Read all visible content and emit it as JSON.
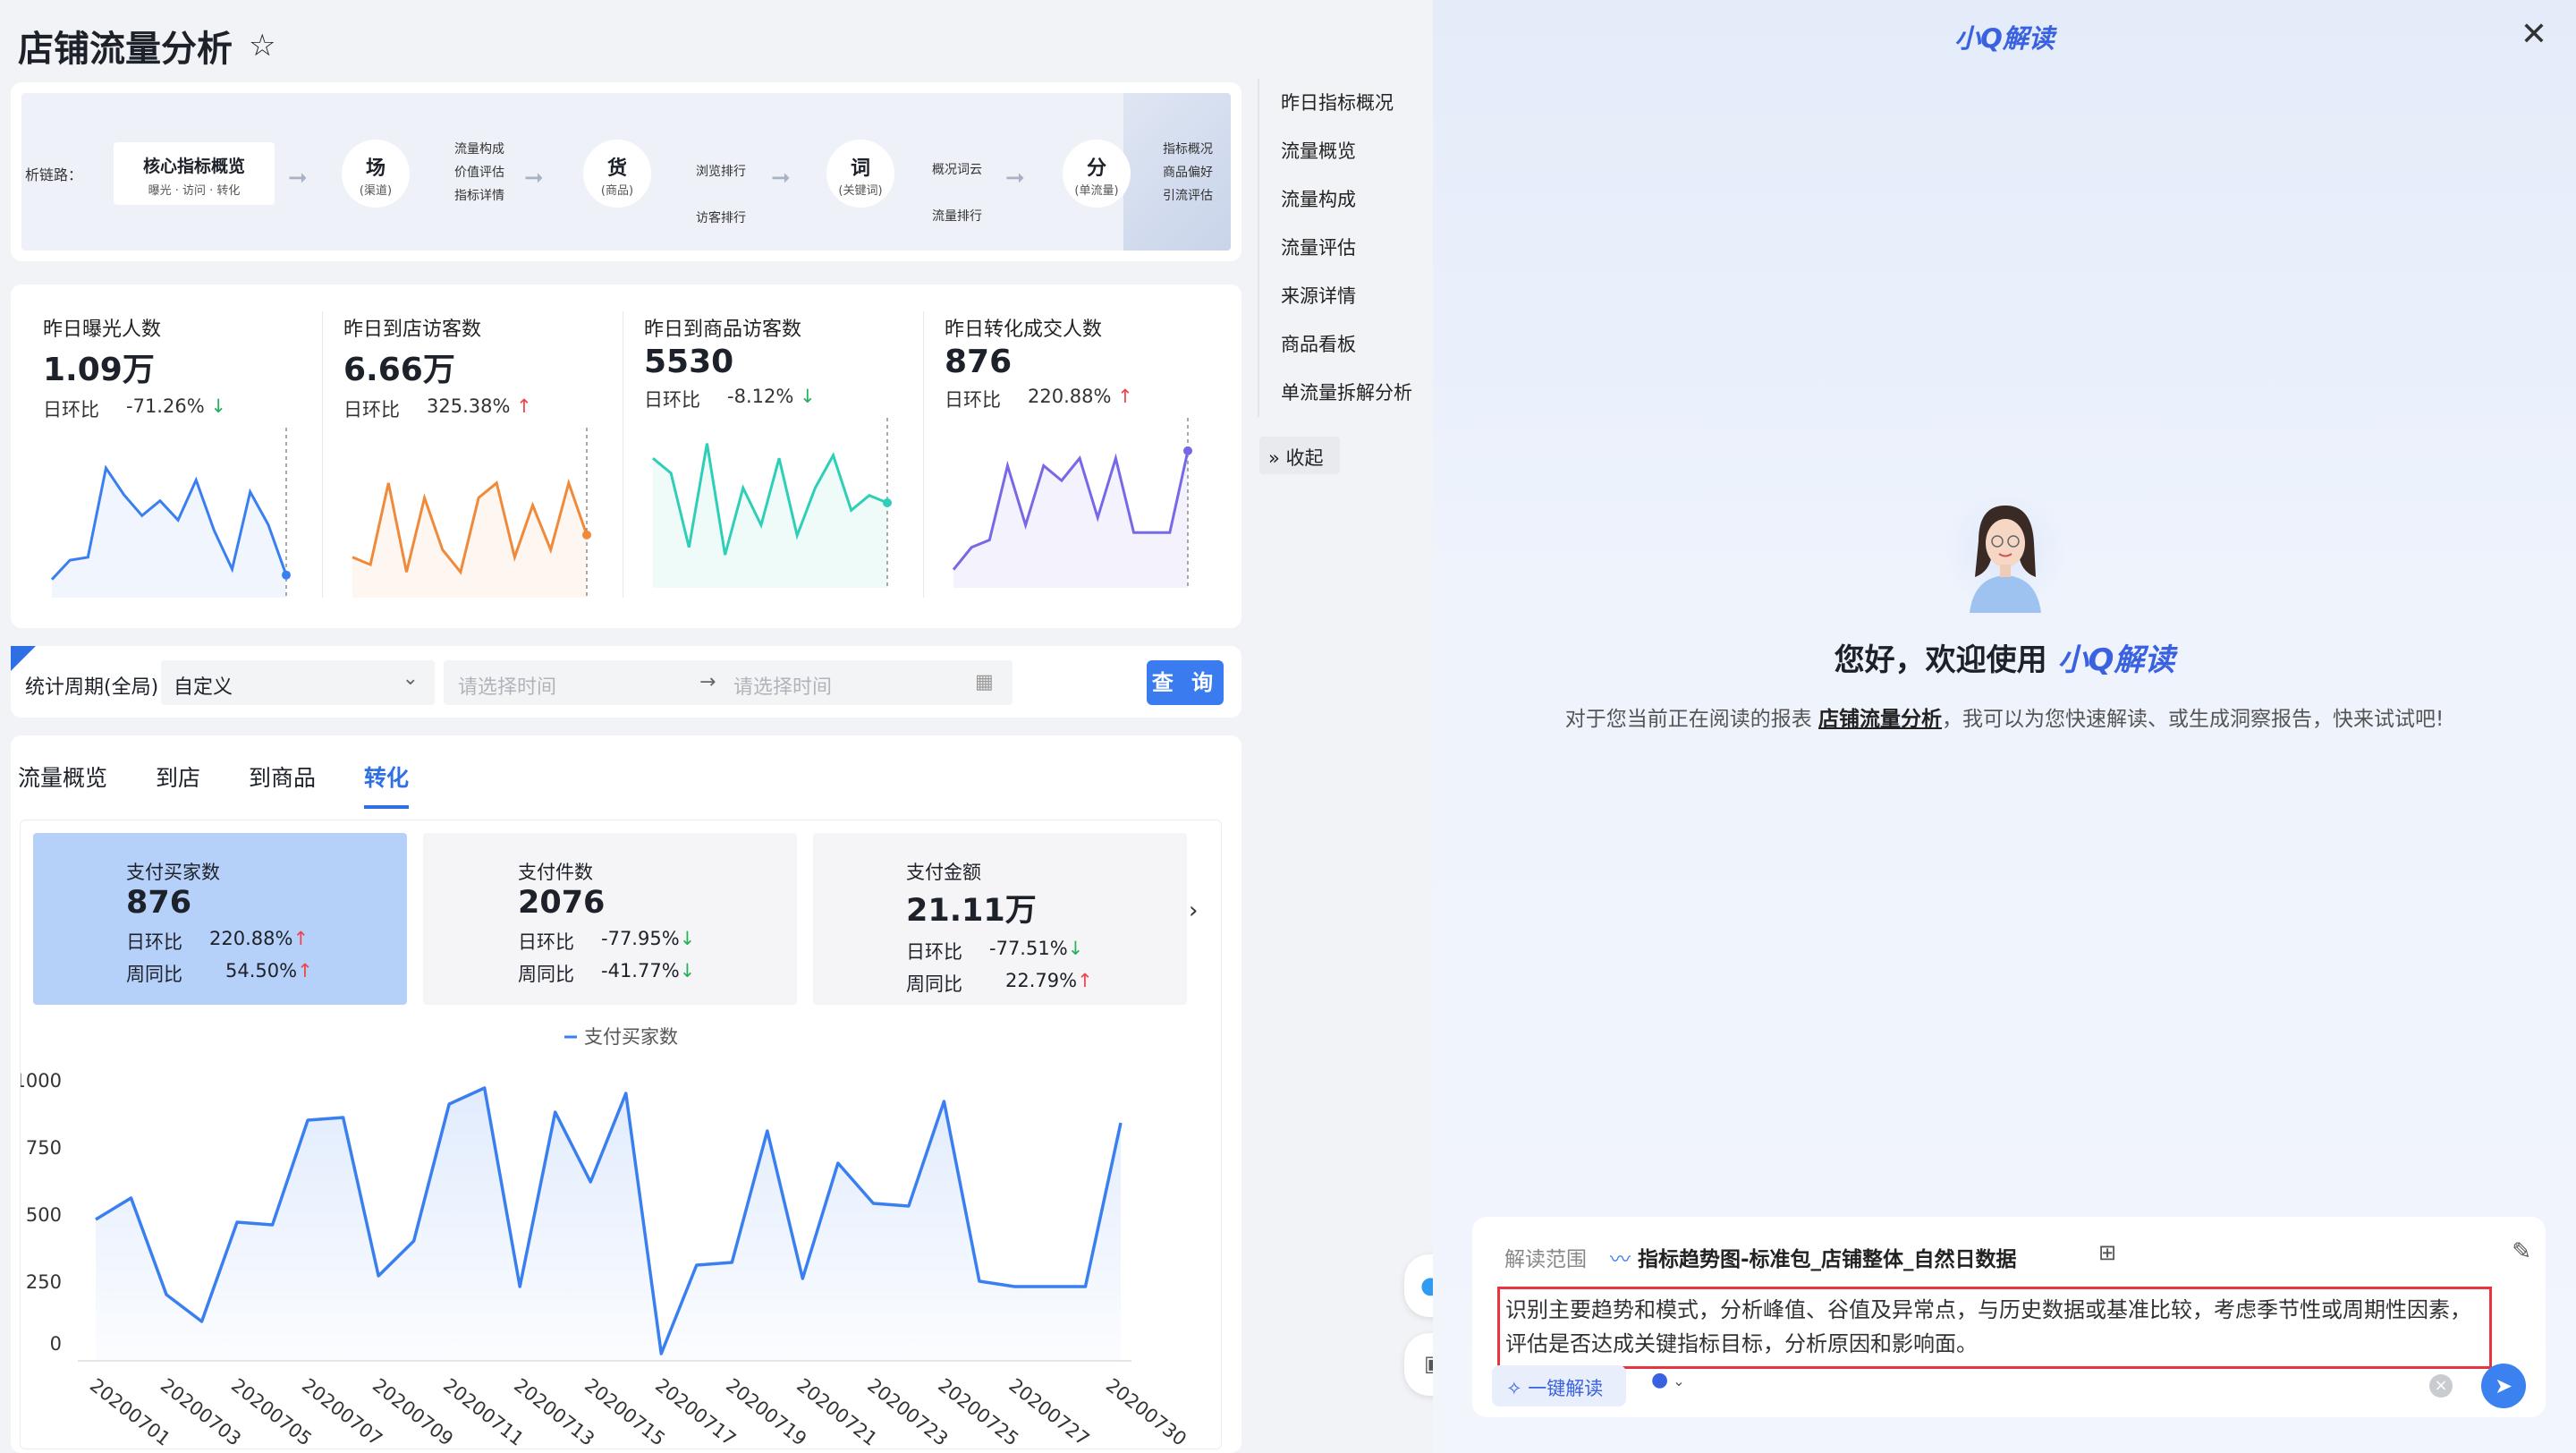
{
  "page": {
    "title": "店铺流量分析"
  },
  "chain": {
    "label": "析链路：",
    "core": {
      "title": "核心指标概览",
      "sub": "曝光 · 访问 · 转化"
    },
    "nodes": [
      {
        "main": "场",
        "sub": "(渠道)",
        "items": [
          "流量构成",
          "价值评估",
          "指标详情"
        ]
      },
      {
        "main": "货",
        "sub": "(商品)",
        "items": [
          "浏览排行",
          "访客排行"
        ]
      },
      {
        "main": "词",
        "sub": "(关键词)",
        "items": [
          "概况词云",
          "流量排行"
        ]
      },
      {
        "main": "分",
        "sub": "(单流量)",
        "items": [
          "指标概况",
          "商品偏好",
          "引流评估"
        ]
      }
    ]
  },
  "kpis": [
    {
      "label": "昨日曝光人数",
      "value": "1.09万",
      "chg_label": "日环比",
      "chg": "-71.26%",
      "dir": "down",
      "color": "#3a7ff0",
      "series": [
        5,
        18,
        20,
        80,
        62,
        48,
        58,
        45,
        72,
        38,
        12,
        64,
        42,
        8
      ]
    },
    {
      "label": "昨日到店访客数",
      "value": "6.66万",
      "chg_label": "日环比",
      "chg": "325.38%",
      "dir": "up",
      "color": "#f08a3a",
      "series": [
        20,
        15,
        70,
        10,
        60,
        25,
        10,
        60,
        70,
        20,
        55,
        25,
        70,
        35
      ]
    },
    {
      "label": "昨日到商品访客数",
      "value": "5530",
      "chg_label": "日环比",
      "chg": "-8.12%",
      "dir": "down",
      "color": "#2dcfb7",
      "series": [
        80,
        70,
        20,
        90,
        15,
        60,
        35,
        80,
        28,
        60,
        82,
        45,
        55,
        50
      ]
    },
    {
      "label": "昨日转化成交人数",
      "value": "876",
      "chg_label": "日环比",
      "chg": "220.88%",
      "dir": "up",
      "color": "#7668e6",
      "series": [
        5,
        20,
        25,
        75,
        35,
        75,
        65,
        80,
        40,
        80,
        30,
        30,
        30,
        85
      ]
    }
  ],
  "filter": {
    "period_label": "统计周期(全局)",
    "period_value": "自定义",
    "start_placeholder": "请选择时间",
    "end_placeholder": "请选择时间",
    "query": "查 询"
  },
  "tabs": [
    "流量概览",
    "到店",
    "到商品",
    "转化"
  ],
  "metric_cards": [
    {
      "label": "支付买家数",
      "value": "876",
      "r1_label": "日环比",
      "r1": "220.88%",
      "r1dir": "up",
      "r2_label": "周同比",
      "r2": "54.50%",
      "r2dir": "up"
    },
    {
      "label": "支付件数",
      "value": "2076",
      "r1_label": "日环比",
      "r1": "-77.95%",
      "r1dir": "down",
      "r2_label": "周同比",
      "r2": "-41.77%",
      "r2dir": "down"
    },
    {
      "label": "支付金额",
      "value": "21.11万",
      "r1_label": "日环比",
      "r1": "-77.51%",
      "r1dir": "down",
      "r2_label": "周同比",
      "r2": "22.79%",
      "r2dir": "up"
    }
  ],
  "nav": {
    "items": [
      "昨日指标概况",
      "流量概览",
      "流量构成",
      "流量评估",
      "来源详情",
      "商品看板",
      "单流量拆解分析"
    ],
    "collapse": "收起"
  },
  "panel": {
    "title": "小Q解读",
    "welcome_prefix": "您好，欢迎使用",
    "welcome_brand": "小Q解读",
    "intro_prefix": "对于您当前正在阅读的报表",
    "intro_report": "店铺流量分析",
    "intro_suffix": "，我可以为您快速解读、或生成洞察报告，快来试试吧!",
    "scope_label": "解读范围",
    "scope_value": "指标趋势图-标准包_店铺整体_自然日数据",
    "prompt": "识别主要趋势和模式，分析峰值、谷值及异常点，与历史数据或基准比较，考虑季节性或周期性因素，评估是否达成关键指标目标，分析原因和影响面。",
    "one_key": "一键解读"
  },
  "chart_data": {
    "type": "area",
    "legend": "支付买家数",
    "x": [
      "20200701",
      "20200702",
      "20200703",
      "20200704",
      "20200705",
      "20200706",
      "20200707",
      "20200708",
      "20200709",
      "20200710",
      "20200711",
      "20200712",
      "20200713",
      "20200714",
      "20200715",
      "20200716",
      "20200717",
      "20200718",
      "20200719",
      "20200720",
      "20200721",
      "20200722",
      "20200723",
      "20200724",
      "20200725",
      "20200726",
      "20200727",
      "20200728",
      "20200729",
      "20200730"
    ],
    "x_tick_labels": [
      "20200701",
      "20200703",
      "20200705",
      "20200707",
      "20200709",
      "20200711",
      "20200713",
      "20200715",
      "20200717",
      "20200719",
      "20200721",
      "20200723",
      "20200725",
      "20200727",
      "20200730"
    ],
    "values": [
      480,
      560,
      200,
      100,
      470,
      460,
      850,
      860,
      270,
      400,
      910,
      970,
      230,
      880,
      620,
      950,
      -20,
      310,
      320,
      810,
      260,
      690,
      540,
      530,
      920,
      250,
      230,
      230,
      230,
      840
    ],
    "yticks": [
      0,
      250,
      500,
      750,
      1000
    ],
    "ylim": [
      0,
      1000
    ]
  }
}
